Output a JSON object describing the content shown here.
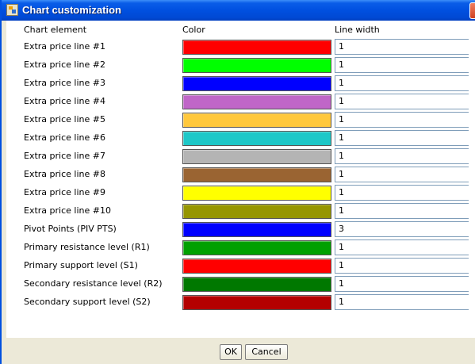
{
  "window": {
    "title": "Chart customization"
  },
  "headers": {
    "element": "Chart element",
    "color": "Color",
    "line_width": "Line width"
  },
  "rows": [
    {
      "label": "Extra price line #1",
      "color": "#ff0000",
      "width": "1"
    },
    {
      "label": "Extra price line #2",
      "color": "#00ff00",
      "width": "1"
    },
    {
      "label": "Extra price line #3",
      "color": "#0000ff",
      "width": "1"
    },
    {
      "label": "Extra price line #4",
      "color": "#c066c8",
      "width": "1"
    },
    {
      "label": "Extra price line #5",
      "color": "#ffc83c",
      "width": "1"
    },
    {
      "label": "Extra price line #6",
      "color": "#1ec8c8",
      "width": "1"
    },
    {
      "label": "Extra price line #7",
      "color": "#b4b4b4",
      "width": "1"
    },
    {
      "label": "Extra price line #8",
      "color": "#9a6432",
      "width": "1"
    },
    {
      "label": "Extra price line #9",
      "color": "#ffff00",
      "width": "1"
    },
    {
      "label": "Extra price line #10",
      "color": "#969600",
      "width": "1"
    },
    {
      "label": "Pivot Points (PIV PTS)",
      "color": "#0000ff",
      "width": "3"
    },
    {
      "label": "Primary resistance level (R1)",
      "color": "#00a000",
      "width": "1"
    },
    {
      "label": "Primary support level (S1)",
      "color": "#ff0000",
      "width": "1"
    },
    {
      "label": "Secondary resistance level (R2)",
      "color": "#007800",
      "width": "1"
    },
    {
      "label": "Secondary support level (S2)",
      "color": "#b40000",
      "width": "1"
    }
  ],
  "buttons": {
    "ok": "OK",
    "cancel": "Cancel"
  },
  "icons": {
    "window_icon": "java-cup-icon",
    "close": "close-icon",
    "dropdown": "chevron-down-icon"
  }
}
